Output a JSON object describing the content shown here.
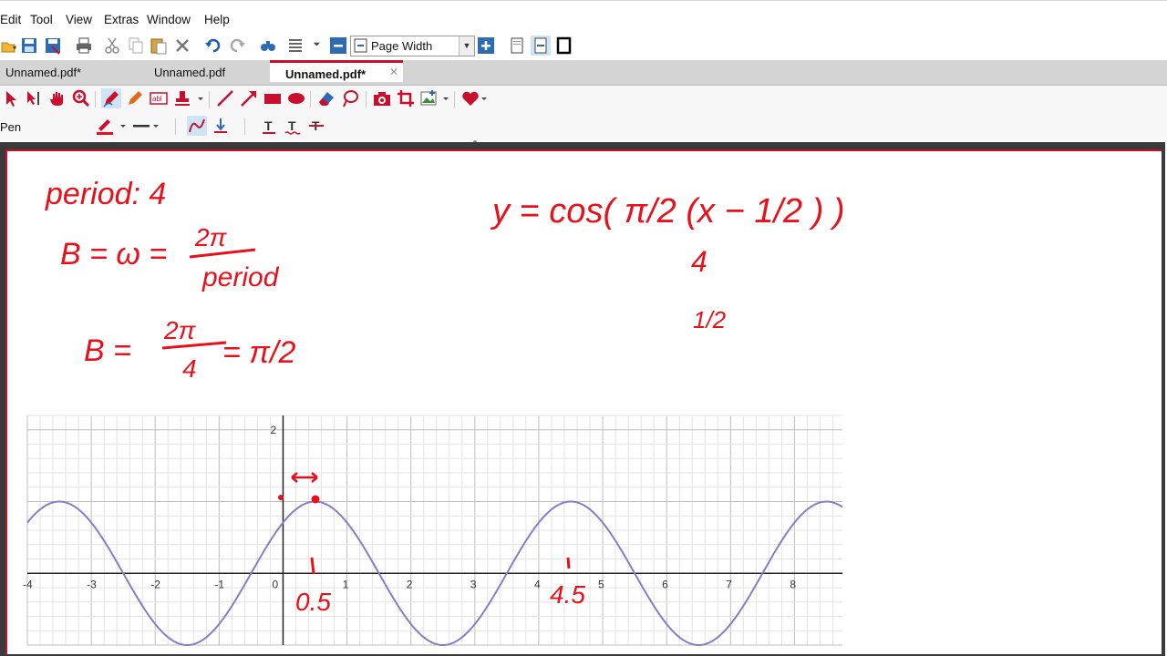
{
  "menu": [
    "Edit",
    "Tool",
    "View",
    "Extras",
    "Window",
    "Help"
  ],
  "zoom": {
    "value": "Page Width"
  },
  "tabs": [
    {
      "label": "Unnamed.pdf*",
      "active": false
    },
    {
      "label": "Unnamed.pdf",
      "active": false
    },
    {
      "label": "Unnamed.pdf*",
      "active": true
    }
  ],
  "tool_label": "Pen",
  "annotation_color": "#e8111b",
  "handwriting": {
    "line1": "period: 4",
    "line2_left": "B = ω = ",
    "line2_num": "2π",
    "line2_den": "period",
    "line3_left": "B = ",
    "line3_num": "2π",
    "line3_den": "4",
    "line3_right": "= π/2",
    "equation": "y = cos( π/2 (x − 1/2 ) )",
    "note_a": "4",
    "note_b": "1/2",
    "mark_a": "0.5",
    "mark_b": "4.5"
  },
  "chart_data": {
    "type": "line",
    "x_ticks": [
      -4,
      -3,
      -2,
      -1,
      0,
      1,
      2,
      3,
      4,
      5,
      6,
      7,
      8
    ],
    "x_tick_labels": [
      "-4",
      "-3",
      "-2",
      "-1",
      "0",
      "1",
      "2",
      "3",
      "4",
      "5",
      "6",
      "7",
      "8"
    ],
    "y_ticks": [
      2
    ],
    "y_tick_labels": [
      "2"
    ],
    "xlim": [
      -4,
      8.75
    ],
    "ylim": [
      -1.0,
      2.2
    ],
    "grid": true,
    "series": [
      {
        "function": "cos(pi/2 * (x - 0.5))",
        "color": "#8a7bc8"
      }
    ]
  }
}
